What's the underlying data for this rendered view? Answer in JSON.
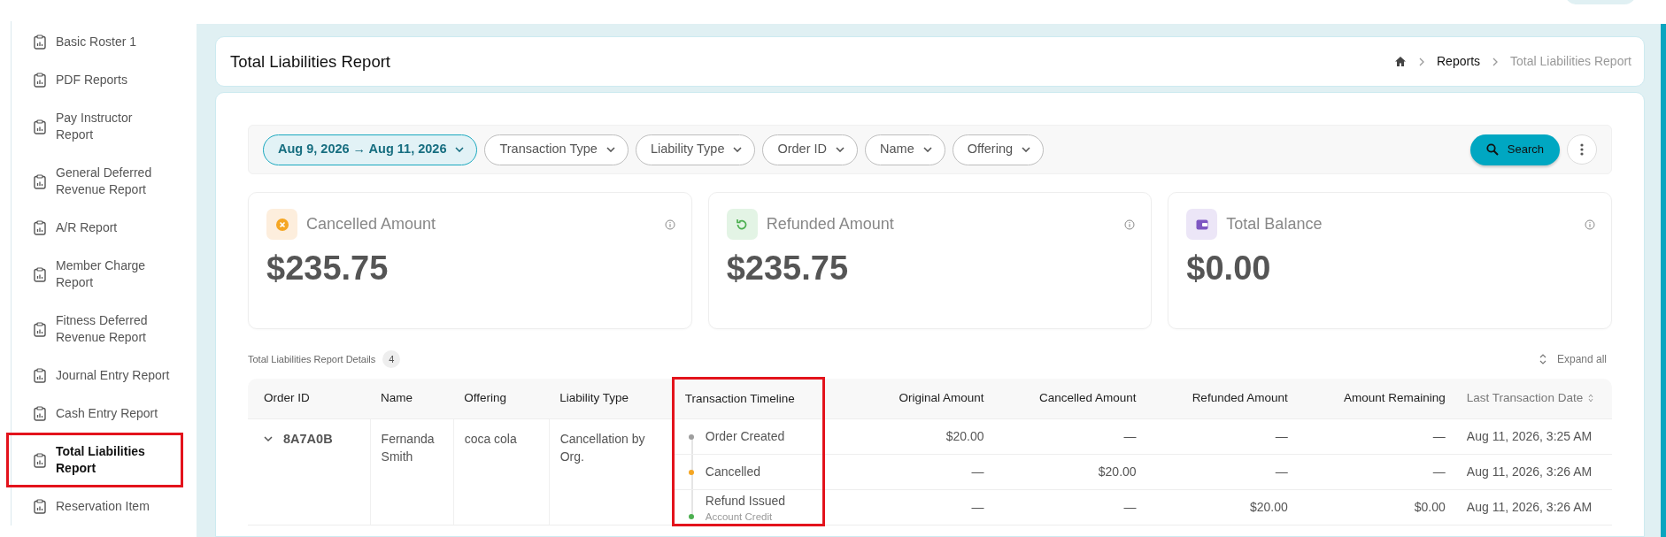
{
  "sidebar": {
    "items": [
      {
        "label_lines": [
          "Basic Roster 1"
        ],
        "selected": false,
        "highlighted": false
      },
      {
        "label_lines": [
          "PDF Reports"
        ],
        "selected": false,
        "highlighted": false
      },
      {
        "label_lines": [
          "Pay Instructor",
          "Report"
        ],
        "selected": false,
        "highlighted": false
      },
      {
        "label_lines": [
          "General Deferred",
          "Revenue Report"
        ],
        "selected": false,
        "highlighted": false
      },
      {
        "label_lines": [
          "A/R Report"
        ],
        "selected": false,
        "highlighted": false
      },
      {
        "label_lines": [
          "Member Charge",
          "Report"
        ],
        "selected": false,
        "highlighted": false
      },
      {
        "label_lines": [
          "Fitness Deferred",
          "Revenue Report"
        ],
        "selected": false,
        "highlighted": false
      },
      {
        "label_lines": [
          "Journal Entry Report"
        ],
        "selected": false,
        "highlighted": false
      },
      {
        "label_lines": [
          "Cash Entry Report"
        ],
        "selected": false,
        "highlighted": false
      },
      {
        "label_lines": [
          "Total Liabilities",
          "Report"
        ],
        "selected": true,
        "highlighted": true
      },
      {
        "label_lines": [
          "Reservation Item"
        ],
        "selected": false,
        "highlighted": false
      }
    ]
  },
  "page": {
    "title": "Total Liabilities Report",
    "breadcrumb": [
      "Reports",
      "Total Liabilities Report"
    ]
  },
  "filters": [
    {
      "label": "Aug 9, 2026 → Aug 11, 2026",
      "active": true
    },
    {
      "label": "Transaction Type",
      "active": false
    },
    {
      "label": "Liability Type",
      "active": false
    },
    {
      "label": "Order ID",
      "active": false
    },
    {
      "label": "Name",
      "active": false
    },
    {
      "label": "Offering",
      "active": false
    }
  ],
  "search_button": "Search",
  "stats": [
    {
      "kind": "cancelled",
      "title": "Cancelled Amount",
      "value": "$235.75"
    },
    {
      "kind": "refunded",
      "title": "Refunded Amount",
      "value": "$235.75"
    },
    {
      "kind": "balance",
      "title": "Total Balance",
      "value": "$0.00"
    }
  ],
  "details": {
    "title": "Total Liabilities Report Details",
    "count": "4",
    "expand_all": "Expand all"
  },
  "table": {
    "columns": [
      {
        "label": "Order ID",
        "highlighted": false
      },
      {
        "label": "Name",
        "highlighted": false
      },
      {
        "label": "Offering",
        "highlighted": false
      },
      {
        "label": "Liability Type",
        "highlighted": false
      },
      {
        "label": "Transaction Timeline",
        "highlighted": true
      },
      {
        "label": "Original Amount",
        "highlighted": false
      },
      {
        "label": "Cancelled Amount",
        "highlighted": false
      },
      {
        "label": "Refunded Amount",
        "highlighted": false
      },
      {
        "label": "Amount Remaining",
        "highlighted": false
      },
      {
        "label": "Last Transaction Date",
        "highlighted": false,
        "sorted": true
      }
    ],
    "rows": [
      {
        "order_id": "8A7A0B",
        "expanded": true,
        "name": "Fernanda Smith",
        "offering": "coca cola",
        "liability_type": "Cancellation by Org.",
        "events": [
          {
            "event": "Order Created",
            "color": "#9e9e9e",
            "original": "$20.00",
            "cancelled": "—",
            "refunded": "—",
            "remaining": "—",
            "date": "Aug 11, 2026, 3:25 AM"
          },
          {
            "event": "Cancelled",
            "color": "#f5a623",
            "original": "—",
            "cancelled": "$20.00",
            "refunded": "—",
            "remaining": "—",
            "date": "Aug 11, 2026, 3:26 AM"
          },
          {
            "event": "Refund Issued",
            "sub": "Account Credit",
            "color": "#4caf50",
            "original": "—",
            "cancelled": "—",
            "refunded": "$20.00",
            "remaining": "$0.00",
            "date": "Aug 11, 2026, 3:26 AM"
          }
        ]
      }
    ]
  }
}
